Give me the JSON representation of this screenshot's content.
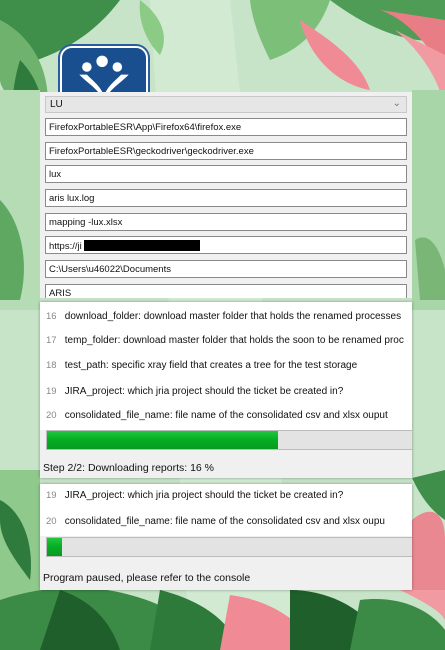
{
  "form": {
    "dropdown_value": "LU",
    "fields": [
      "FirefoxPortableESR\\App\\Firefox64\\firefox.exe",
      "FirefoxPortableESR\\geckodriver\\geckodriver.exe",
      "lux",
      "aris lux.log",
      "mapping -lux.xlsx",
      "https://ji",
      "C:\\Users\\u46022\\Documents",
      "ARIS"
    ]
  },
  "window1": {
    "lines": [
      {
        "num": "16",
        "text": "download_folder: download master folder that holds the renamed processes"
      },
      {
        "num": "17",
        "text": "temp_folder: download master folder that holds the soon to be renamed proc"
      },
      {
        "num": "18",
        "text": "test_path: specific xray field that creates a tree for the test storage"
      },
      {
        "num": "19",
        "text": "JIRA_project: which jria project should the ticket be created in?"
      },
      {
        "num": "20",
        "text": "consolidated_file_name: file name of the consolidated csv and xlsx ouput"
      }
    ],
    "progress": 0.63,
    "status": "Step 2/2: Downloading reports: 16 %"
  },
  "window2": {
    "lines": [
      {
        "num": "19",
        "text": "JIRA_project: which jria project should the ticket be created in?"
      },
      {
        "num": "20",
        "text": "consolidated_file_name: file name of the consolidated csv and xlsx oupu"
      }
    ],
    "progress": 0.04,
    "status": "Program paused, please refer to the console"
  },
  "colors": {
    "progress_green": "#06b025",
    "logo_blue": "#1a4f8f"
  },
  "icons": [
    "jira-logo-icon",
    "chevron-down-icon"
  ]
}
